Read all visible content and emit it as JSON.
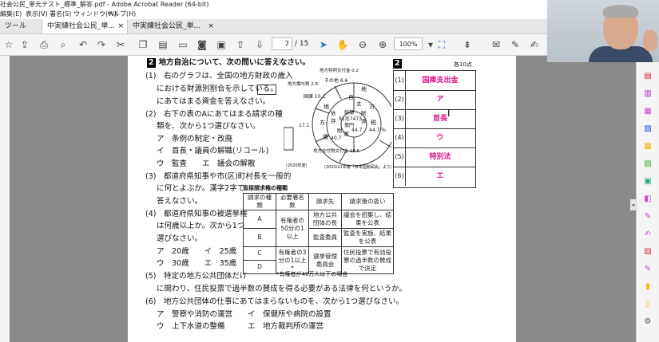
{
  "window": {
    "title": "社会公民_単元テスト_標準_解答.pdf - Adobe Acrobat Reader (64-bit)"
  },
  "menu": [
    "編集(E)",
    "表示(V)",
    "署名(S)",
    "ウィンドウ(W)",
    "ヘルプ(H)"
  ],
  "tabs": {
    "tools": "ツール",
    "doc1": "中実練社会公民_単...",
    "doc2": "中実練社会公民_単...",
    "close": "×"
  },
  "toolbar": {
    "page_current": "7",
    "page_total": "/ 15",
    "zoom": "100%"
  },
  "doc": {
    "q_number": "2",
    "q_title": "地方自治について、次の問いに答えなさい。",
    "points": "各10点",
    "ans_header": "2",
    "lines": [
      "(1)　右のグラフは、全国の地方財政の歳入",
      "における財源別割合を示している。",
      "にあてはまる資金を答えなさい。",
      "(2)　右下の表のAにあてはまる請求の種",
      "類を、次から1つ選びなさい。",
      "ア　条例の制定・改廃",
      "イ　首長・議員の解職(リコール)",
      "ウ　監査　　エ　議会の解散",
      "(3)　都道府県知事や市(区)町村長を一般的",
      "に何とよぶか。漢字2字で",
      "答えなさい。",
      "(4)　都道府県知事の被選挙権",
      "は何歳以上か。次から1つ",
      "選びなさい。",
      "ア　20歳　　イ　25歳",
      "ウ　30歳　　エ　35歳",
      "(5)　特定の地方公共団体だけ",
      "に関わり、住民投票で過半数の賛成を得る必要がある法律を何というか。",
      "(6)　地方公共団体の仕事にあてはまらないものを、次から1つ選びなさい。",
      "ア　警察や消防の運営　　イ　保健所や病院の設置",
      "ウ　上下水道の整備　　　エ　地方裁判所の運営"
    ],
    "answers": [
      {
        "n": "(1)",
        "v": "国庫支出金"
      },
      {
        "n": "(2)",
        "v": "ア"
      },
      {
        "n": "(3)",
        "v": "首長"
      },
      {
        "n": "(4)",
        "v": "ウ"
      },
      {
        "n": "(5)",
        "v": "特別法"
      },
      {
        "n": "(6)",
        "v": "エ"
      }
    ],
    "chart": {
      "top_label": "地方特例交付金 0.2",
      "center1": "総額",
      "center2": "91兆7473",
      "center3": "億円",
      "outer_labels": [
        "地",
        "方",
        "税",
        "地",
        "方",
        "債"
      ],
      "inner_labels": [
        "自",
        "主",
        "財",
        "源",
        "依",
        "存",
        "財",
        "源"
      ],
      "values": [
        "その他 6.6",
        "地方譲与税 2.8",
        "国庫 10.1",
        "17.1",
        "44.7",
        "40.7",
        "44.7 %",
        "地方交付税交付金 18.5"
      ],
      "note_left": "(2020年度)",
      "note_right": "(2020/21年版「日本国勢図会」より)"
    },
    "table": {
      "title": "直接請求権の種類",
      "headers": [
        "請求の種類",
        "必要署名数",
        "請求先",
        "請求後の扱い"
      ],
      "rows": [
        [
          "A",
          "有権者の50分の1以上",
          "地方公共団体の長",
          "議会を招集し、結果を公表"
        ],
        [
          "B",
          "",
          "監査委員",
          "監査を実施、結果を公表"
        ],
        [
          "C",
          "有権者の3分の1以上*",
          "選挙管理委員会",
          "住民投票で有効投票の過半数の賛成で決定"
        ],
        [
          "D",
          "",
          "",
          ""
        ]
      ],
      "footnote": "*有権者が40万人以下の場合"
    }
  }
}
